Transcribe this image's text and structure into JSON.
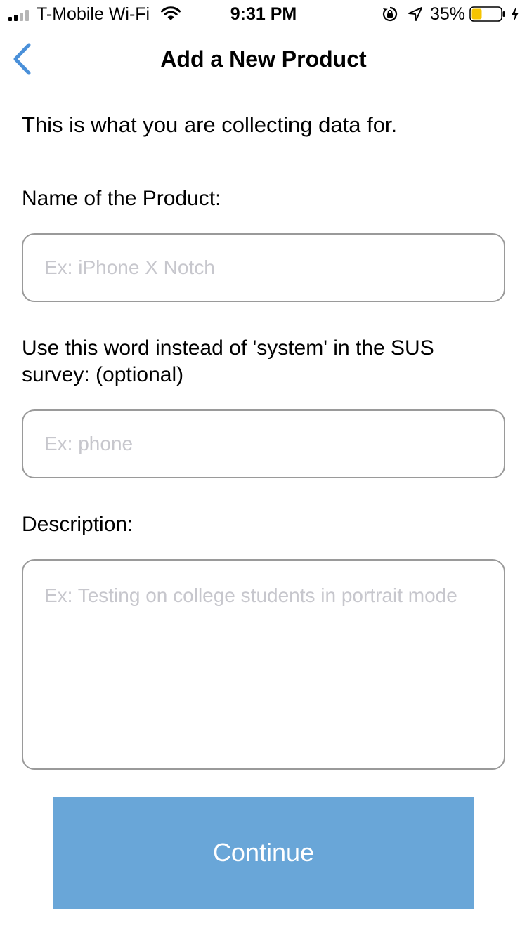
{
  "status_bar": {
    "carrier": "T-Mobile Wi-Fi",
    "time": "9:31 PM",
    "battery_percent": "35%",
    "battery_level": 0.35,
    "battery_color": "#f5c400",
    "icons": [
      "signal-icon",
      "wifi-icon",
      "rotation-lock-icon",
      "location-arrow-icon",
      "battery-icon",
      "charging-bolt-icon"
    ]
  },
  "nav": {
    "title": "Add a New Product",
    "back_icon": "chevron-left-icon",
    "accent_color": "#4a90d9"
  },
  "form": {
    "intro": "This is what you are collecting data for.",
    "product_name_label": "Name of the Product:",
    "product_name_placeholder": "Ex: iPhone X Notch",
    "product_name_value": "",
    "system_word_label": "Use this word instead of 'system' in the SUS survey: (optional)",
    "system_word_placeholder": "Ex: phone",
    "system_word_value": "",
    "description_label": "Description:",
    "description_placeholder": "Ex: Testing on college students in portrait mode",
    "description_value": ""
  },
  "actions": {
    "continue_label": "Continue",
    "continue_color": "#69a6d8"
  }
}
